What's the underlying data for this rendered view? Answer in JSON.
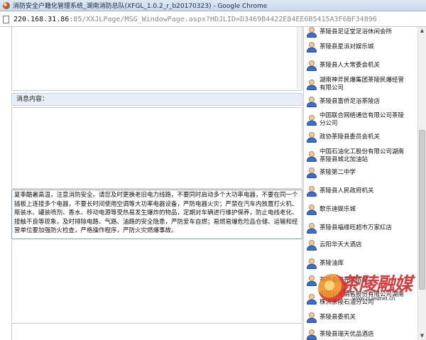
{
  "window": {
    "title": "消防安全户籍化管理系统_湖南消防总队(XFGL_1.0.2_r_b20170323) - Google Chrome"
  },
  "address": {
    "host": "220.168.31.86",
    "rest": ":85/XXJLPage/MSG_WindowPage.aspx?HDJLID=D3469B4422E84EE6B5415A3F6BF34896"
  },
  "message": {
    "label": "消息内容：",
    "text": "夏季酷暑高温，注意消防安全。请您及时更换老旧电力线路，不要同时启动多个大功率电器，不要在同一个插板上连接多个电器，不要长时间使用空调等大功率电器设备，严防电器火灾；严禁在汽车内放置打火机、瓶装水、罐装喷剂、香水、移动电源等受热易发生爆炸的物品，定期对车辆进行维护保养，防止电线老化、接触不良等现象，及时排除电路、气路、油路的安全隐患，严防爱车自燃；易燃易爆危险品仓储、运输和经营单位要加强防火检查，严格操作程序，严防火灾燃爆事故。"
  },
  "recipients": [
    "茶陵县足证堂足浴休闲会所",
    "茶陵县星派对娱乐城",
    "茶陵县人大常委会机关",
    "湖南神斧民爆集团茶陵民爆经营有限公司",
    "茶陵县富侨足浴茶陵店",
    "中国联合网络通信有限公司茶陵分公司",
    "政协茶陵县委员会机关",
    "中国石油化工股份有限公司湖南茶陵县城北加油站",
    "茶陵第二中学",
    "茶陵县人民政府机关",
    "歌乐迪娱乐城",
    "茶陵县福缘旺超市万家红店",
    "云阳华天大酒店",
    "茶陵油库",
    "茶陵县阳光足浴城",
    "中国石化销售股份有限公司湖南株洲茶陵石油分公司",
    "茶陵县委机关",
    "茶陵县瑞天优品酒店"
  ],
  "watermark": {
    "brand": "茶陵融媒",
    "url": "www.cl.rednet.cn"
  }
}
